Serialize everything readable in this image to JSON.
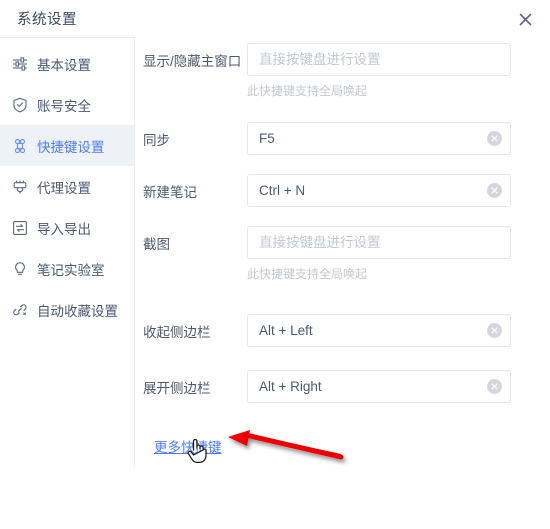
{
  "window": {
    "title": "系统设置",
    "close_icon": "close-icon"
  },
  "sidebar": {
    "items": [
      {
        "label": "基本设置",
        "icon": "sliders-icon",
        "active": false
      },
      {
        "label": "账号安全",
        "icon": "shield-check-icon",
        "active": false
      },
      {
        "label": "快捷键设置",
        "icon": "command-keyboard-icon",
        "active": true
      },
      {
        "label": "代理设置",
        "icon": "plug-proxy-icon",
        "active": false
      },
      {
        "label": "导入导出",
        "icon": "import-export-icon",
        "active": false
      },
      {
        "label": "笔记实验室",
        "icon": "lightbulb-icon",
        "active": false
      },
      {
        "label": "自动收藏设置",
        "icon": "link-auto-collect-icon",
        "active": false
      }
    ]
  },
  "main": {
    "rows": [
      {
        "label": "显示/隐藏主窗口",
        "value": "",
        "placeholder": "直接按键盘进行设置",
        "hint": "此快捷键支持全局唤起",
        "has_clear": false
      },
      {
        "label": "同步",
        "value": "F5",
        "placeholder": "",
        "hint": "",
        "has_clear": true
      },
      {
        "label": "新建笔记",
        "value": "Ctrl + N",
        "placeholder": "",
        "hint": "",
        "has_clear": true
      },
      {
        "label": "截图",
        "value": "",
        "placeholder": "直接按键盘进行设置",
        "hint": "此快捷键支持全局唤起",
        "has_clear": false
      },
      {
        "label": "收起侧边栏",
        "value": "Alt + Left",
        "placeholder": "",
        "hint": "",
        "has_clear": true
      },
      {
        "label": "展开侧边栏",
        "value": "Alt + Right",
        "placeholder": "",
        "hint": "",
        "has_clear": true
      }
    ],
    "more_link": "更多快捷键"
  },
  "annotation": {
    "arrow_color": "#ee0000",
    "cursor": "pointing-hand-cursor"
  },
  "colors": {
    "accent": "#4d7cfe",
    "text": "#4b5a72",
    "placeholder": "#c2c8d2",
    "border": "#e4e7ec",
    "active_bg": "#eef2f7"
  }
}
